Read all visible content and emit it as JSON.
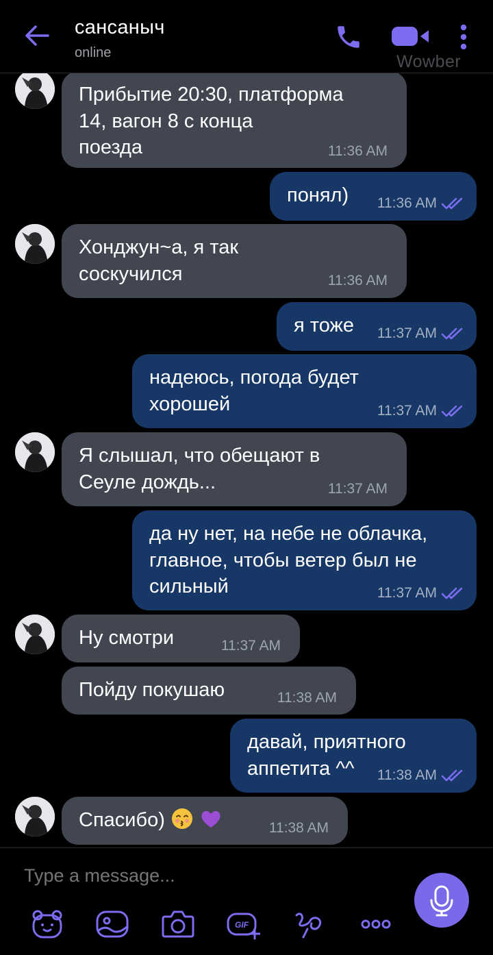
{
  "header": {
    "title": "сансаныч",
    "status": "online",
    "watermark": "Wowber",
    "icons": [
      "back-arrow-icon",
      "phone-icon",
      "video-camera-icon",
      "more-vertical-icon"
    ]
  },
  "colors": {
    "accent": "#7b6cf0",
    "incoming_bubble": "#414651",
    "outgoing_bubble": "#173766",
    "read_ticks": "#7b6cf0"
  },
  "messages": [
    {
      "direction": "incoming",
      "text": "Прибытие 20:30, платформа\n14, вагон 8 с конца\nпоезда",
      "time": "11:36 AM"
    },
    {
      "direction": "outgoing",
      "text": "понял)",
      "time": "11:36 AM",
      "status": "read"
    },
    {
      "direction": "incoming",
      "text": "Хонджун~а, я так\nсоскучился",
      "time": "11:36 AM"
    },
    {
      "direction": "outgoing",
      "text": "я тоже",
      "time": "11:37 AM",
      "status": "read"
    },
    {
      "direction": "outgoing",
      "text": "надеюсь, погода будет\nхорошей",
      "time": "11:37 AM",
      "status": "read"
    },
    {
      "direction": "incoming",
      "text": "Я слышал, что обещают в\nСеуле дождь...",
      "time": "11:37 AM"
    },
    {
      "direction": "outgoing",
      "text": "да ну нет, на небе не облачка,\nглавное, чтобы ветер был не\nсильный",
      "time": "11:37 AM",
      "status": "read"
    },
    {
      "direction": "incoming",
      "text": "Ну смотри",
      "time": "11:37 AM"
    },
    {
      "direction": "incoming",
      "text": "Пойду покушаю",
      "time": "11:38 AM"
    },
    {
      "direction": "outgoing",
      "text": "давай, приятного\nаппетита ^^",
      "time": "11:38 AM",
      "status": "read"
    },
    {
      "direction": "incoming",
      "text": "Спасибо)",
      "emojis": [
        "kissing-face-emoji",
        "purple-heart-emoji"
      ],
      "time": "11:38 AM"
    }
  ],
  "composer": {
    "placeholder": "Type a message...",
    "toolbar_icons": [
      "sticker-bear-icon",
      "gallery-icon",
      "camera-icon",
      "gif-icon",
      "doodle-icon",
      "more-horizontal-icon"
    ],
    "send_icon": "microphone-icon"
  }
}
